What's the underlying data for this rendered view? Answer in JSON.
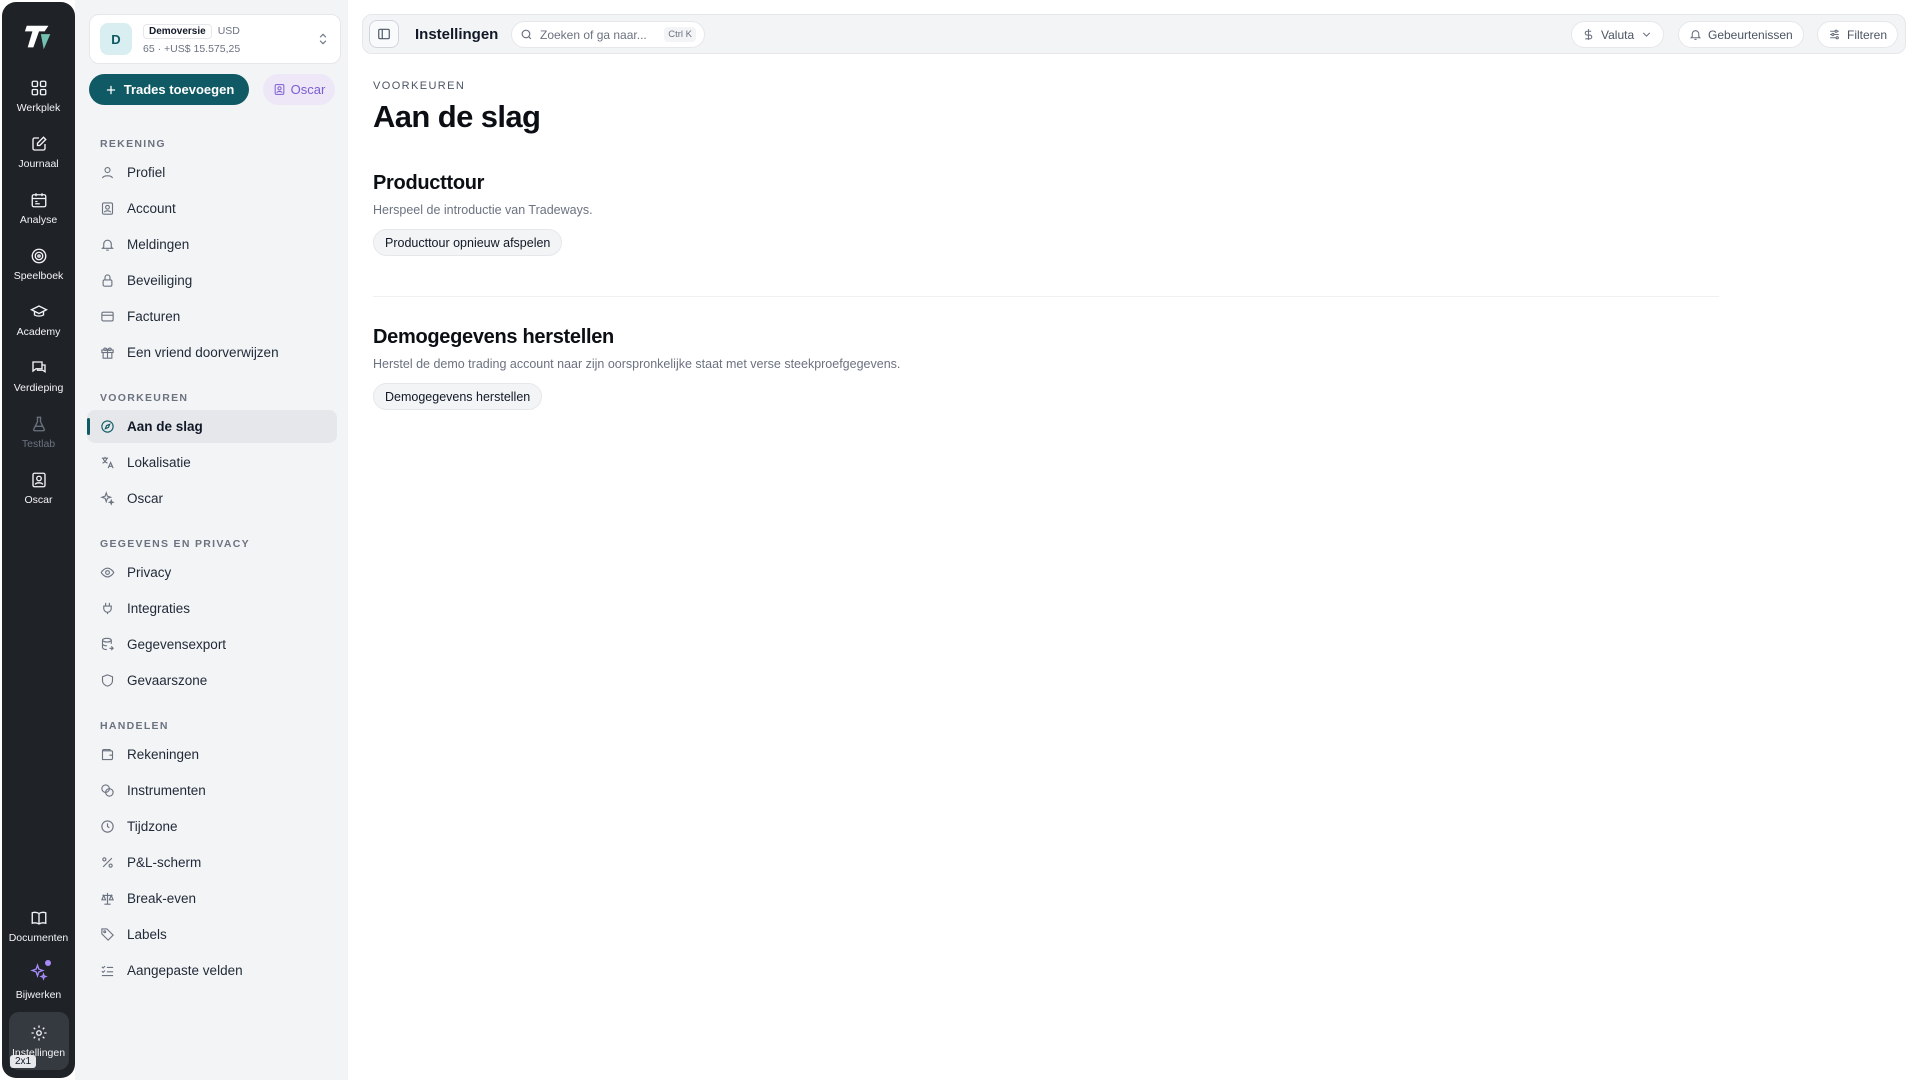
{
  "rail": {
    "items": [
      {
        "label": "Werkplek",
        "icon": "grid-icon"
      },
      {
        "label": "Journaal",
        "icon": "edit-note-icon"
      },
      {
        "label": "Analyse",
        "icon": "calendar-icon"
      },
      {
        "label": "Speelboek",
        "icon": "target-icon"
      },
      {
        "label": "Academy",
        "icon": "graduation-cap-icon"
      },
      {
        "label": "Verdieping",
        "icon": "chat-icon"
      },
      {
        "label": "Testlab",
        "icon": "flask-icon"
      },
      {
        "label": "Oscar",
        "icon": "contact-icon"
      }
    ],
    "bottom": [
      {
        "label": "Documenten",
        "icon": "book-icon"
      },
      {
        "label": "Bijwerken",
        "icon": "sparkle-icon"
      },
      {
        "label": "Instellingen",
        "icon": "gear-icon"
      }
    ],
    "size_badge": "2x1"
  },
  "account": {
    "avatar_letter": "D",
    "name": "Demoversie",
    "currency": "USD",
    "summary": "65 · +US$ 15.575,25"
  },
  "actions": {
    "add_trades": "Trades toevoegen",
    "oscar": "Oscar"
  },
  "nav": {
    "sections": [
      {
        "title": "REKENING",
        "items": [
          "Profiel",
          "Account",
          "Meldingen",
          "Beveiliging",
          "Facturen",
          "Een vriend doorverwijzen"
        ]
      },
      {
        "title": "VOORKEUREN",
        "items": [
          "Aan de slag",
          "Lokalisatie",
          "Oscar"
        ]
      },
      {
        "title": "GEGEVENS EN PRIVACY",
        "items": [
          "Privacy",
          "Integraties",
          "Gegevensexport",
          "Gevaarszone"
        ]
      },
      {
        "title": "HANDELEN",
        "items": [
          "Rekeningen",
          "Instrumenten",
          "Tijdzone",
          "P&L-scherm",
          "Break-even",
          "Labels",
          "Aangepaste velden"
        ]
      }
    ],
    "active_item": "Aan de slag"
  },
  "topbar": {
    "title": "Instellingen",
    "search_placeholder": "Zoeken of ga naar...",
    "search_shortcut": "Ctrl K",
    "currency": "Valuta",
    "events": "Gebeurtenissen",
    "filters": "Filteren"
  },
  "main": {
    "eyebrow": "VOORKEUREN",
    "title": "Aan de slag",
    "tour": {
      "title": "Producttour",
      "description": "Herspeel de introductie van Tradeways.",
      "button": "Producttour opnieuw afspelen"
    },
    "demo": {
      "title": "Demogegevens herstellen",
      "description": "Herstel de demo trading account naar zijn oorspronkelijke staat met verse steekproefgegevens.",
      "button": "Demogegevens herstellen"
    }
  },
  "colors": {
    "rail_bg": "#1f2328",
    "accent": "#0f5a64",
    "oscar_purple": "#7c5ccf"
  }
}
